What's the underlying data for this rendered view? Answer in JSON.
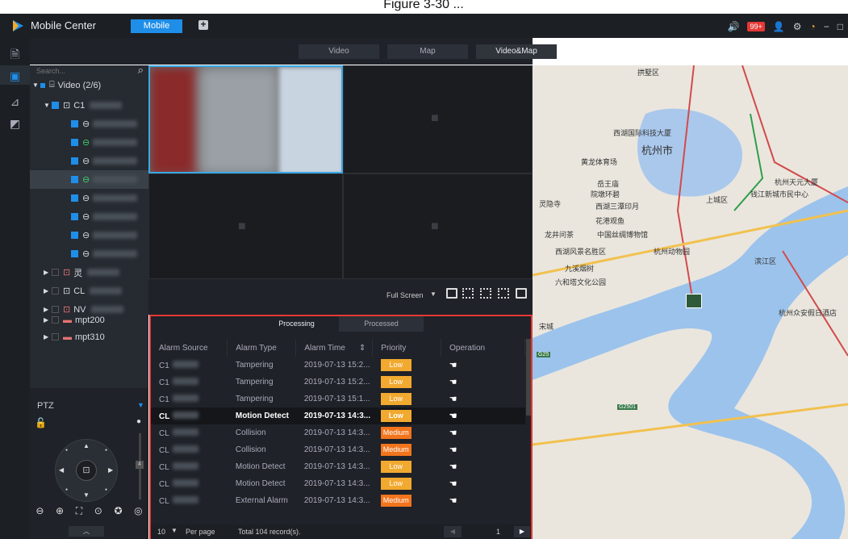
{
  "caption": "Figure 3-30 ... ",
  "app": {
    "title": "Mobile Center",
    "tab_mobile": "Mobile",
    "alarm_count": "99+"
  },
  "view_tabs": [
    "Video",
    "Map",
    "Video&Map"
  ],
  "search": {
    "placeholder": "Search..."
  },
  "tree": {
    "root": "Video (2/6)",
    "group1": "C1",
    "group2": "灵",
    "group3": "CL",
    "group4": "NV",
    "device5": "mpt200",
    "device6": "mpt310"
  },
  "ptz": {
    "title": "PTZ",
    "speed": "4"
  },
  "video_toolbar": {
    "full_screen": "Full Screen"
  },
  "alarm": {
    "tabs": [
      "Processing",
      "Processed"
    ],
    "columns": [
      "Alarm Source",
      "Alarm Type",
      "Alarm Time",
      "Priority",
      "Operation"
    ],
    "rows": [
      {
        "source": "C1",
        "type": "Tampering",
        "time": "2019-07-13 15:2...",
        "priority": "Low"
      },
      {
        "source": "C1",
        "type": "Tampering",
        "time": "2019-07-13 15:2...",
        "priority": "Low"
      },
      {
        "source": "C1",
        "type": "Tampering",
        "time": "2019-07-13 15:1...",
        "priority": "Low"
      },
      {
        "source": "CL",
        "type": "Motion Detect",
        "time": "2019-07-13 14:3...",
        "priority": "Low"
      },
      {
        "source": "CL",
        "type": "Collision",
        "time": "2019-07-13 14:3...",
        "priority": "Medium"
      },
      {
        "source": "CL",
        "type": "Collision",
        "time": "2019-07-13 14:3...",
        "priority": "Medium"
      },
      {
        "source": "CL",
        "type": "Motion Detect",
        "time": "2019-07-13 14:3...",
        "priority": "Low"
      },
      {
        "source": "CL",
        "type": "Motion Detect",
        "time": "2019-07-13 14:3...",
        "priority": "Low"
      },
      {
        "source": "CL",
        "type": "External Alarm",
        "time": "2019-07-13 14:3...",
        "priority": "Medium"
      }
    ],
    "footer": {
      "per_page_value": "10",
      "per_page": "Per page",
      "total": "Total 104 record(s).",
      "page": "1"
    }
  },
  "map_labels": [
    "拱墅区",
    "西湖国际科技大厦",
    "杭州市",
    "黄龙体育场",
    "岳王庙",
    "院墩环碧",
    "西湖三潭印月",
    "花港观鱼",
    "中国丝绸博物馆",
    "灵隐寺",
    "龙井问茶",
    "西湖风景名胜区",
    "九溪烟树",
    "六和塔文化公园",
    "杭州动物园",
    "钱江新城市民中心",
    "杭州天元大厦",
    "上城区",
    "滨江区",
    "宋城",
    "杭州众安假日酒店",
    "G2501",
    "G25"
  ],
  "colors": {
    "accent": "#1e8ee8",
    "alarm_border": "#e53935",
    "low": "#f2a930",
    "medium": "#f2741c"
  }
}
